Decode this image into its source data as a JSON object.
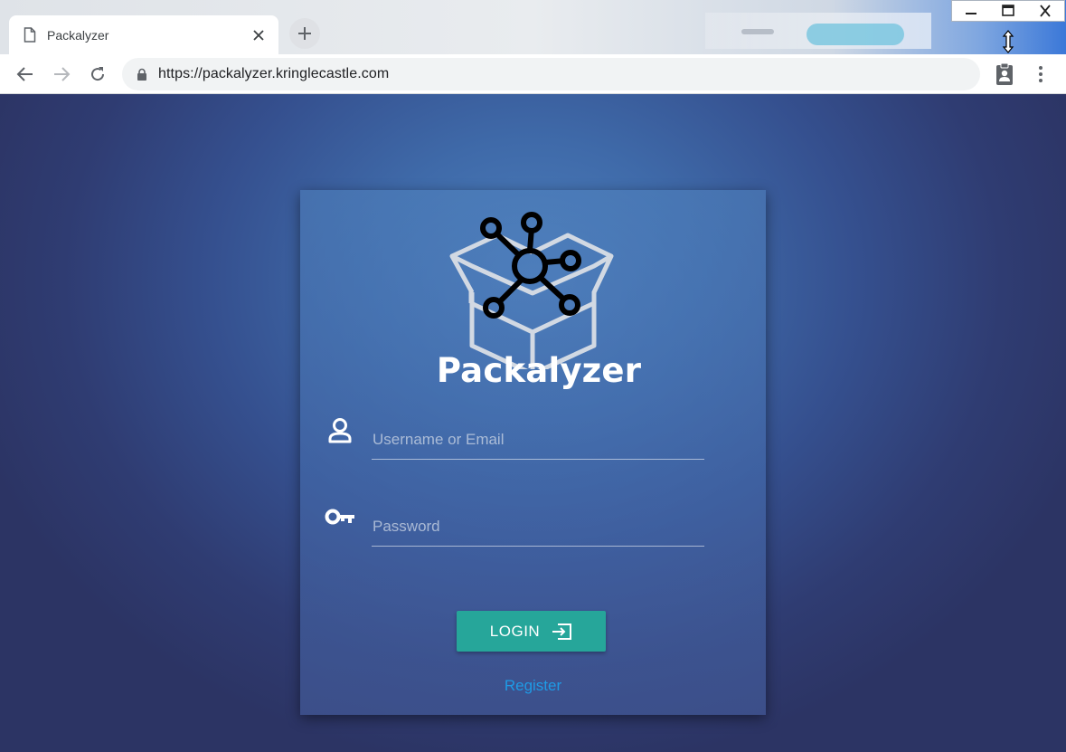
{
  "window": {
    "minimize_icon": "minimize-icon",
    "maximize_icon": "maximize-icon",
    "close_icon": "close-icon"
  },
  "browser": {
    "tab": {
      "title": "Packalyzer",
      "icon": "page-icon"
    },
    "new_tab_icon": "plus-icon",
    "url": "https://packalyzer.kringlecastle.com",
    "nav": {
      "back": "arrow-left-icon",
      "forward": "arrow-right-icon",
      "reload": "reload-icon"
    }
  },
  "login": {
    "brand": "Packalyzer",
    "username_placeholder": "Username or Email",
    "password_placeholder": "Password",
    "login_label": "LOGIN",
    "register_label": "Register"
  },
  "colors": {
    "login_button": "#26a69a",
    "register_link": "#1e9be6",
    "page_background": "#3f6aa9"
  }
}
